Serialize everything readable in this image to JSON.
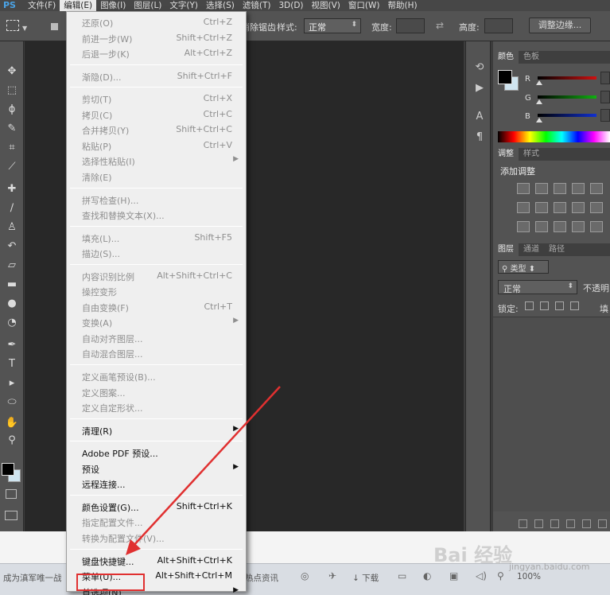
{
  "app_logo": "PS",
  "menubar": [
    {
      "label": "文件(F)",
      "active": false
    },
    {
      "label": "编辑(E)",
      "active": true
    },
    {
      "label": "图像(I)",
      "active": false
    },
    {
      "label": "图层(L)",
      "active": false
    },
    {
      "label": "文字(Y)",
      "active": false
    },
    {
      "label": "选择(S)",
      "active": false
    },
    {
      "label": "滤镜(T)",
      "active": false
    },
    {
      "label": "3D(D)",
      "active": false
    },
    {
      "label": "视图(V)",
      "active": false
    },
    {
      "label": "窗口(W)",
      "active": false
    },
    {
      "label": "帮助(H)",
      "active": false
    }
  ],
  "options_bar": {
    "antialias_fragment": "消除锯齿",
    "style_label": "样式:",
    "style_value": "正常",
    "width_label": "宽度:",
    "height_label": "高度:",
    "refine_edge_button": "调整边缘..."
  },
  "edit_menu": [
    {
      "type": "item",
      "label": "还原(O)",
      "shortcut": "Ctrl+Z",
      "enabled": false
    },
    {
      "type": "item",
      "label": "前进一步(W)",
      "shortcut": "Shift+Ctrl+Z",
      "enabled": false
    },
    {
      "type": "item",
      "label": "后退一步(K)",
      "shortcut": "Alt+Ctrl+Z",
      "enabled": false
    },
    {
      "type": "sep"
    },
    {
      "type": "item",
      "label": "渐隐(D)...",
      "shortcut": "Shift+Ctrl+F",
      "enabled": false
    },
    {
      "type": "sep"
    },
    {
      "type": "item",
      "label": "剪切(T)",
      "shortcut": "Ctrl+X",
      "enabled": false
    },
    {
      "type": "item",
      "label": "拷贝(C)",
      "shortcut": "Ctrl+C",
      "enabled": false
    },
    {
      "type": "item",
      "label": "合并拷贝(Y)",
      "shortcut": "Shift+Ctrl+C",
      "enabled": false
    },
    {
      "type": "item",
      "label": "粘贴(P)",
      "shortcut": "Ctrl+V",
      "enabled": false
    },
    {
      "type": "item",
      "label": "选择性粘贴(I)",
      "shortcut": "",
      "enabled": false,
      "submenu": true
    },
    {
      "type": "item",
      "label": "清除(E)",
      "shortcut": "",
      "enabled": false
    },
    {
      "type": "sep"
    },
    {
      "type": "item",
      "label": "拼写检查(H)...",
      "shortcut": "",
      "enabled": false
    },
    {
      "type": "item",
      "label": "查找和替换文本(X)...",
      "shortcut": "",
      "enabled": false
    },
    {
      "type": "sep"
    },
    {
      "type": "item",
      "label": "填充(L)...",
      "shortcut": "Shift+F5",
      "enabled": false
    },
    {
      "type": "item",
      "label": "描边(S)...",
      "shortcut": "",
      "enabled": false
    },
    {
      "type": "sep"
    },
    {
      "type": "item",
      "label": "内容识别比例",
      "shortcut": "Alt+Shift+Ctrl+C",
      "enabled": false
    },
    {
      "type": "item",
      "label": "操控变形",
      "shortcut": "",
      "enabled": false
    },
    {
      "type": "item",
      "label": "自由变换(F)",
      "shortcut": "Ctrl+T",
      "enabled": false
    },
    {
      "type": "item",
      "label": "变换(A)",
      "shortcut": "",
      "enabled": false,
      "submenu": true
    },
    {
      "type": "item",
      "label": "自动对齐图层...",
      "shortcut": "",
      "enabled": false
    },
    {
      "type": "item",
      "label": "自动混合图层...",
      "shortcut": "",
      "enabled": false
    },
    {
      "type": "sep"
    },
    {
      "type": "item",
      "label": "定义画笔预设(B)...",
      "shortcut": "",
      "enabled": false
    },
    {
      "type": "item",
      "label": "定义图案...",
      "shortcut": "",
      "enabled": false
    },
    {
      "type": "item",
      "label": "定义自定形状...",
      "shortcut": "",
      "enabled": false
    },
    {
      "type": "sep"
    },
    {
      "type": "item",
      "label": "清理(R)",
      "shortcut": "",
      "enabled": true,
      "submenu": true
    },
    {
      "type": "sep"
    },
    {
      "type": "item",
      "label": "Adobe PDF 预设...",
      "shortcut": "",
      "enabled": true
    },
    {
      "type": "item",
      "label": "预设",
      "shortcut": "",
      "enabled": true,
      "submenu": true
    },
    {
      "type": "item",
      "label": "远程连接...",
      "shortcut": "",
      "enabled": true
    },
    {
      "type": "sep"
    },
    {
      "type": "item",
      "label": "颜色设置(G)...",
      "shortcut": "Shift+Ctrl+K",
      "enabled": true
    },
    {
      "type": "item",
      "label": "指定配置文件...",
      "shortcut": "",
      "enabled": false
    },
    {
      "type": "item",
      "label": "转换为配置文件(V)...",
      "shortcut": "",
      "enabled": false
    },
    {
      "type": "sep"
    },
    {
      "type": "item",
      "label": "键盘快捷键...",
      "shortcut": "Alt+Shift+Ctrl+K",
      "enabled": true
    },
    {
      "type": "item",
      "label": "菜单(U)...",
      "shortcut": "Alt+Shift+Ctrl+M",
      "enabled": true
    },
    {
      "type": "item",
      "label": "首选项(N)",
      "shortcut": "",
      "enabled": true,
      "submenu": true,
      "highlighted": true
    }
  ],
  "panels": {
    "color_tabs": [
      "颜色",
      "色板"
    ],
    "rgb_labels": [
      "R",
      "G",
      "B"
    ],
    "slider_colors": [
      "#d01010",
      "#10b010",
      "#1030d0"
    ],
    "adjust_tabs": [
      "调整",
      "样式"
    ],
    "adjust_title": "添加调整",
    "layers_tabs": [
      "图层",
      "通道",
      "路径"
    ],
    "layer_filter": "类型",
    "blend_mode": "正常",
    "opacity_label": "不透明",
    "lock_label": "锁定:",
    "fill_label": "填"
  },
  "taskbar": {
    "left_text": "成为滇军唯一战",
    "hot_text": "热点资讯",
    "download_text": "下载",
    "zoom_text": "100%"
  },
  "watermark": {
    "main": "Bai 经验",
    "sub": "jingyan.baidu.com"
  },
  "accent_colors": {
    "highlight_box": "#e03030",
    "arrow": "#e03030"
  }
}
